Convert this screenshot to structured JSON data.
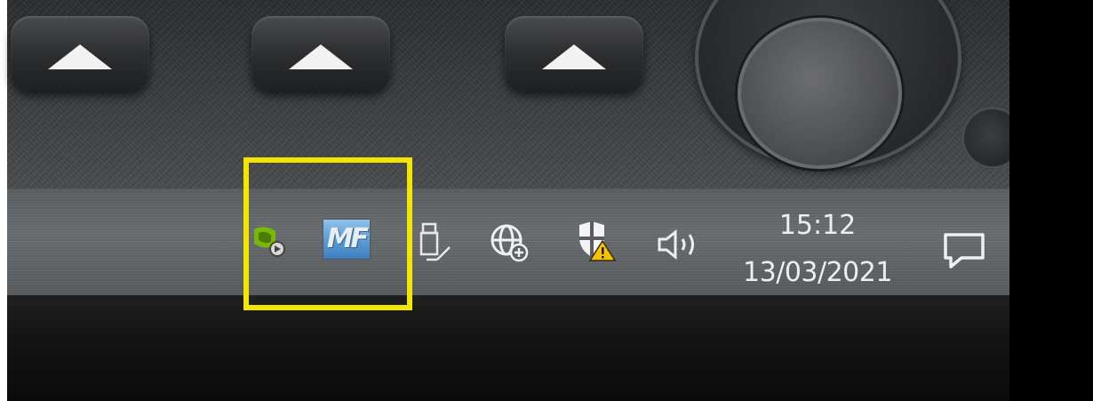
{
  "taskbar": {
    "clock": {
      "time": "15:12",
      "date": "13/03/2021"
    },
    "tray_icons": [
      {
        "name": "nvidia-icon"
      },
      {
        "name": "mf-app-icon",
        "label": "MF"
      },
      {
        "name": "usb-eject-icon"
      },
      {
        "name": "network-globe-icon"
      },
      {
        "name": "security-shield-warning-icon"
      },
      {
        "name": "speaker-volume-icon"
      },
      {
        "name": "action-center-icon"
      }
    ]
  },
  "annotation": {
    "highlight_color": "#f2e600"
  }
}
